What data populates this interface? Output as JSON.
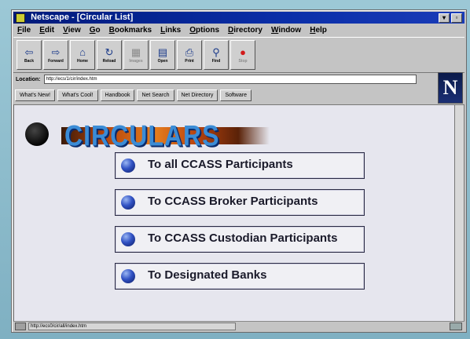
{
  "window": {
    "title": "Netscape - [Circular List]"
  },
  "menu": [
    "File",
    "Edit",
    "View",
    "Go",
    "Bookmarks",
    "Links",
    "Options",
    "Directory",
    "Window",
    "Help"
  ],
  "toolbar": [
    {
      "label": "Back",
      "icon": "back-arrow-icon",
      "glyph": "⇦"
    },
    {
      "label": "Forward",
      "icon": "forward-arrow-icon",
      "glyph": "⇨"
    },
    {
      "label": "Home",
      "icon": "home-icon",
      "glyph": "⌂"
    },
    {
      "label": "Reload",
      "icon": "reload-icon",
      "glyph": "↻"
    },
    {
      "label": "Images",
      "icon": "images-icon",
      "glyph": "▦"
    },
    {
      "label": "Open",
      "icon": "open-icon",
      "glyph": "▤"
    },
    {
      "label": "Print",
      "icon": "print-icon",
      "glyph": "⎙"
    },
    {
      "label": "Find",
      "icon": "find-icon",
      "glyph": "⚲"
    },
    {
      "label": "Stop",
      "icon": "stop-icon",
      "glyph": "●"
    }
  ],
  "location": {
    "label": "Location:",
    "url": "http://ecs/1/cir/index.htm"
  },
  "directory_buttons": [
    "What's New!",
    "What's Cool!",
    "Handbook",
    "Net Search",
    "Net Directory",
    "Software"
  ],
  "logo": "N",
  "page": {
    "heading": "CIRCULARS",
    "links": [
      "To all CCASS Participants",
      "To CCASS Broker Participants",
      "To CCASS Custodian Participants",
      "To Designated Banks"
    ]
  },
  "status": {
    "text": "http://ecs0/cir/all/index.htm"
  }
}
